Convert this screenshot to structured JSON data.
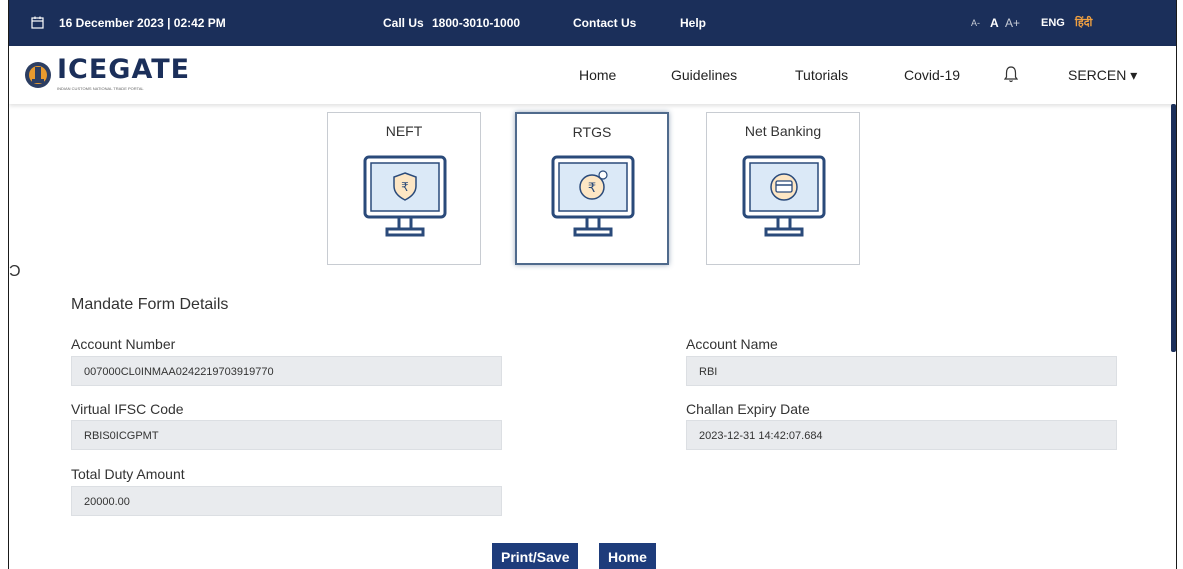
{
  "topbar": {
    "datetime": "16 December 2023 | 02:42 PM",
    "call_label": "Call Us",
    "call_number": "1800-3010-1000",
    "contact": "Contact Us",
    "help": "Help",
    "font_small": "A-",
    "font_normal": "A",
    "font_large": "A+",
    "lang_en": "ENG",
    "lang_hi": "हिंदी"
  },
  "header": {
    "logo_text": "ICEGATE",
    "logo_sub": "INDIAN CUSTOMS NATIONAL TRADE PORTAL",
    "nav": [
      "Home",
      "Guidelines",
      "Tutorials",
      "Covid-19"
    ],
    "user": "SERCEN ▾",
    "icons": [
      "bell-icon",
      "calendar-icon"
    ]
  },
  "payment_options": [
    {
      "label": "NEFT",
      "icon": "shield-rupee-icon",
      "selected": false
    },
    {
      "label": "RTGS",
      "icon": "rupee-coin-icon",
      "selected": true
    },
    {
      "label": "Net Banking",
      "icon": "card-icon",
      "selected": false
    }
  ],
  "form": {
    "title": "Mandate Form Details",
    "account_number_label": "Account Number",
    "account_number": "007000CL0INMAA0242219703919770",
    "account_name_label": "Account Name",
    "account_name": "RBI",
    "ifsc_label": "Virtual IFSC Code",
    "ifsc": "RBIS0ICGPMT",
    "expiry_label": "Challan Expiry Date",
    "expiry": "2023-12-31 14:42:07.684",
    "duty_label": "Total Duty Amount",
    "duty": "20000.00"
  },
  "buttons": {
    "print": "Print/Save",
    "home": "Home"
  },
  "colors": {
    "navy": "#1b2f5a",
    "button": "#1e3c7b",
    "field_bg": "#e9ebee",
    "accent_orange": "#f0a040"
  }
}
